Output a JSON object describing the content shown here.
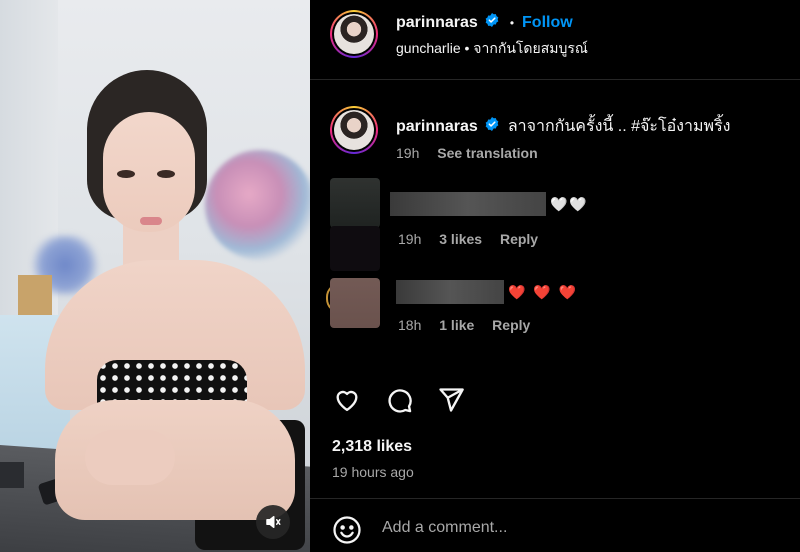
{
  "post": {
    "author": "parinnaras",
    "follow_label": "Follow",
    "location_user": "guncharlie",
    "location_text": "จากกันโดยสมบูรณ์",
    "separator": "•",
    "caption": "ลาจากกันครั้งนี้ .. #จ๊ะโอ๋งามพริ้ง",
    "caption_age": "19h",
    "see_translation": "See translation",
    "likes": "2,318 likes",
    "posted_ago": "19 hours ago"
  },
  "comments": [
    {
      "text": "🤍🤍",
      "age": "19h",
      "likes": "3 likes",
      "reply": "Reply"
    },
    {
      "text": "❤️ ❤️ ❤️",
      "age": "18h",
      "likes": "1 like",
      "reply": "Reply"
    }
  ],
  "comment_box": {
    "placeholder": "Add a comment..."
  },
  "icons": {
    "verified": "verified-badge-icon",
    "like": "heart-icon",
    "comment": "comment-bubble-icon",
    "share": "paper-plane-icon",
    "emoji": "smiley-icon",
    "mute": "speaker-muted-icon"
  },
  "colors": {
    "accent": "#0095f6",
    "background": "#000000",
    "muted_text": "#a8a8a8",
    "verified": "#0095f6"
  }
}
